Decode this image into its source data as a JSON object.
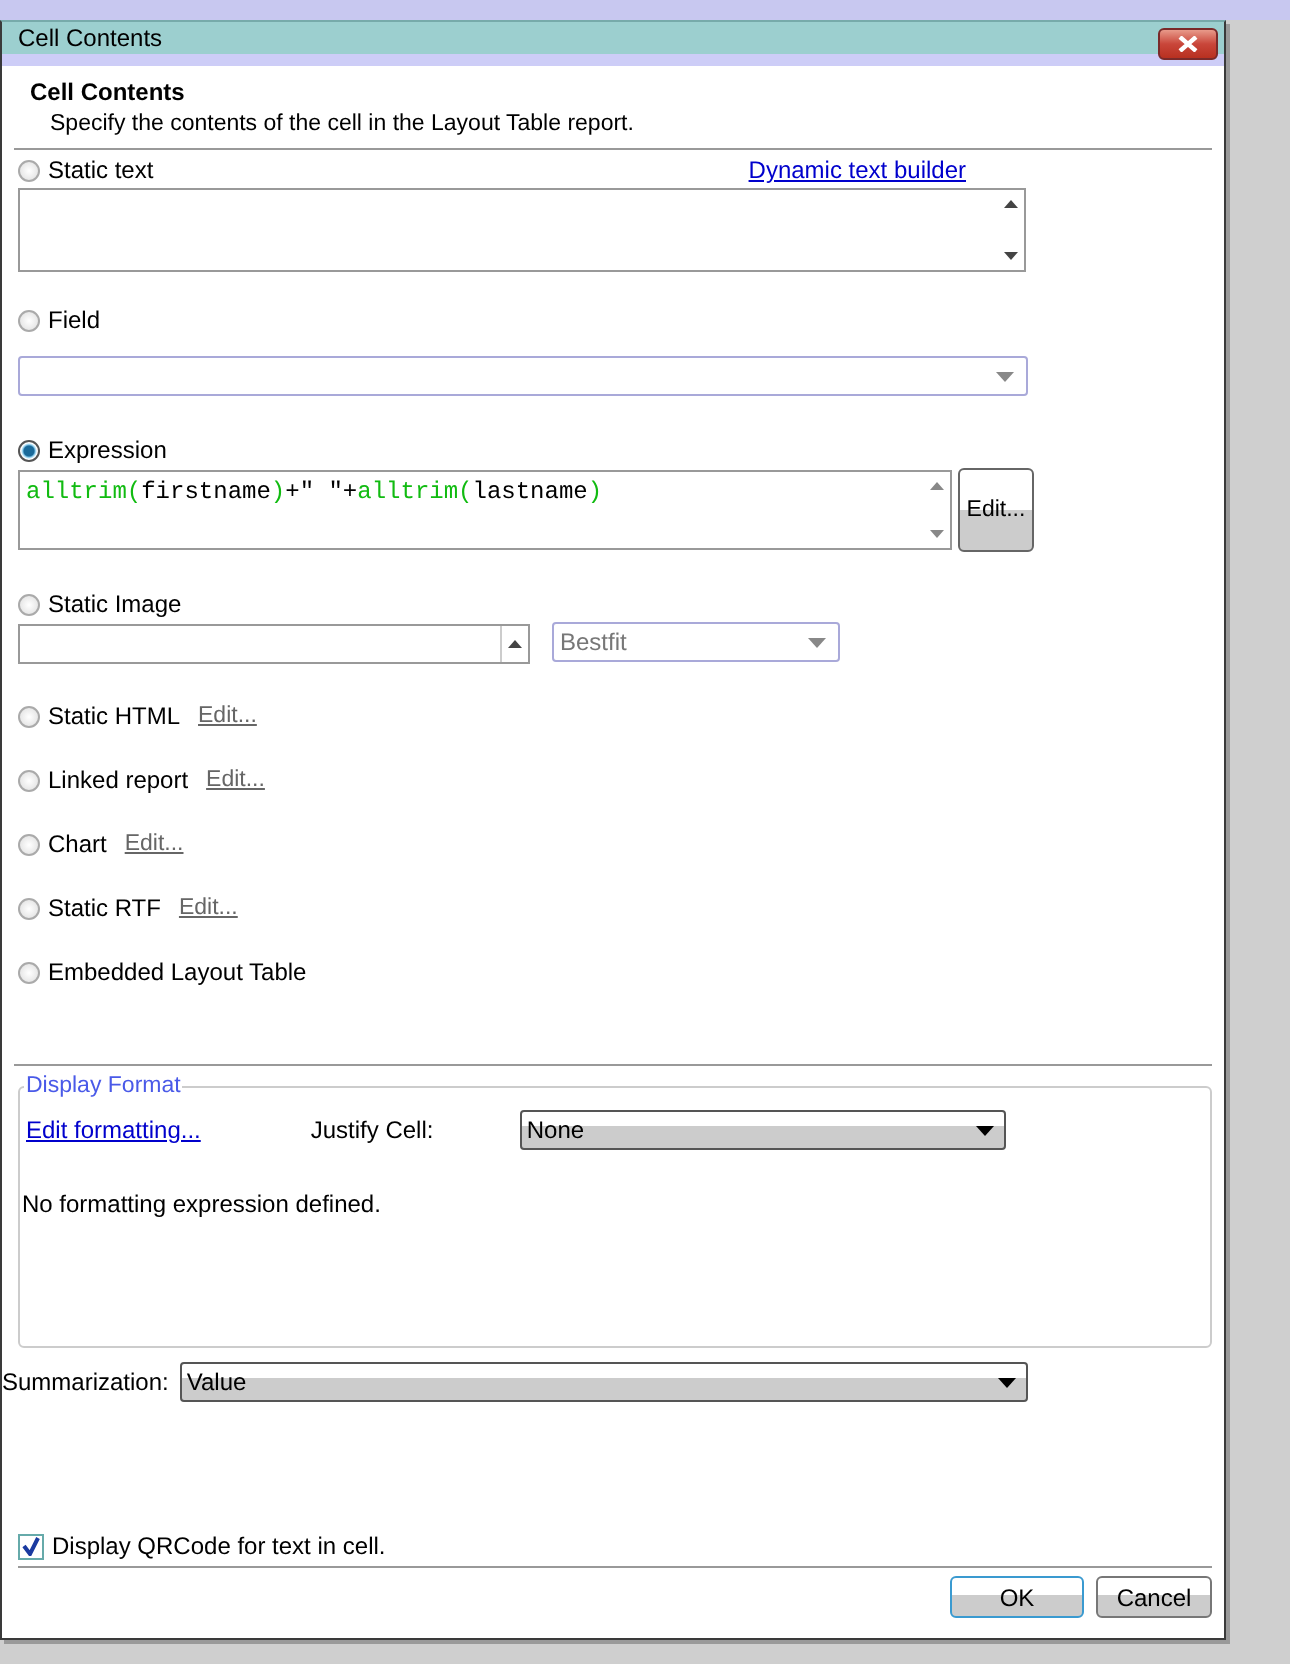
{
  "window": {
    "title": "Cell Contents"
  },
  "header": {
    "title": "Cell Contents",
    "subtitle": "Specify the contents of the cell in the Layout Table report."
  },
  "options": [
    {
      "kind": "text",
      "label": "Static text",
      "selected": false,
      "link": "Dynamic text builder"
    },
    {
      "kind": "combo",
      "label": "Field",
      "selected": false
    },
    {
      "kind": "expression",
      "label": "Expression",
      "selected": true,
      "button": "Edit...",
      "tokens": [
        {
          "kind": "function",
          "text": "alltrim("
        },
        {
          "kind": "name",
          "text": "firstname"
        },
        {
          "kind": "function",
          "text": ")"
        },
        {
          "kind": "operator",
          "text": "+\" \"+"
        },
        {
          "kind": "function",
          "text": "alltrim("
        },
        {
          "kind": "name",
          "text": "lastname"
        },
        {
          "kind": "function",
          "text": ")"
        }
      ]
    },
    {
      "kind": "image",
      "label": "Static Image",
      "selected": false,
      "mode": "Bestfit"
    },
    {
      "kind": "edit",
      "label": "Static HTML",
      "selected": false,
      "edit_link": "Edit..."
    },
    {
      "kind": "edit",
      "label": "Linked report",
      "selected": false,
      "edit_link": "Edit..."
    },
    {
      "kind": "edit",
      "label": "Chart",
      "selected": false,
      "edit_link": "Edit..."
    },
    {
      "kind": "edit",
      "label": "Static RTF",
      "selected": false,
      "edit_link": "Edit..."
    },
    {
      "kind": "plain",
      "label": "Embedded Layout Table",
      "selected": false
    }
  ],
  "display_format": {
    "legend": "Display Format",
    "edit_link": "Edit formatting...",
    "justify_label": "Justify Cell:",
    "justify_value": "None",
    "message": "No formatting expression defined."
  },
  "summarization": {
    "label": "Summarization:",
    "value": "Value"
  },
  "qrcode": {
    "label": "Display QRCode for text in cell.",
    "checked": true
  },
  "buttons": [
    {
      "label": "OK",
      "default": true
    },
    {
      "label": "Cancel",
      "default": false
    }
  ]
}
